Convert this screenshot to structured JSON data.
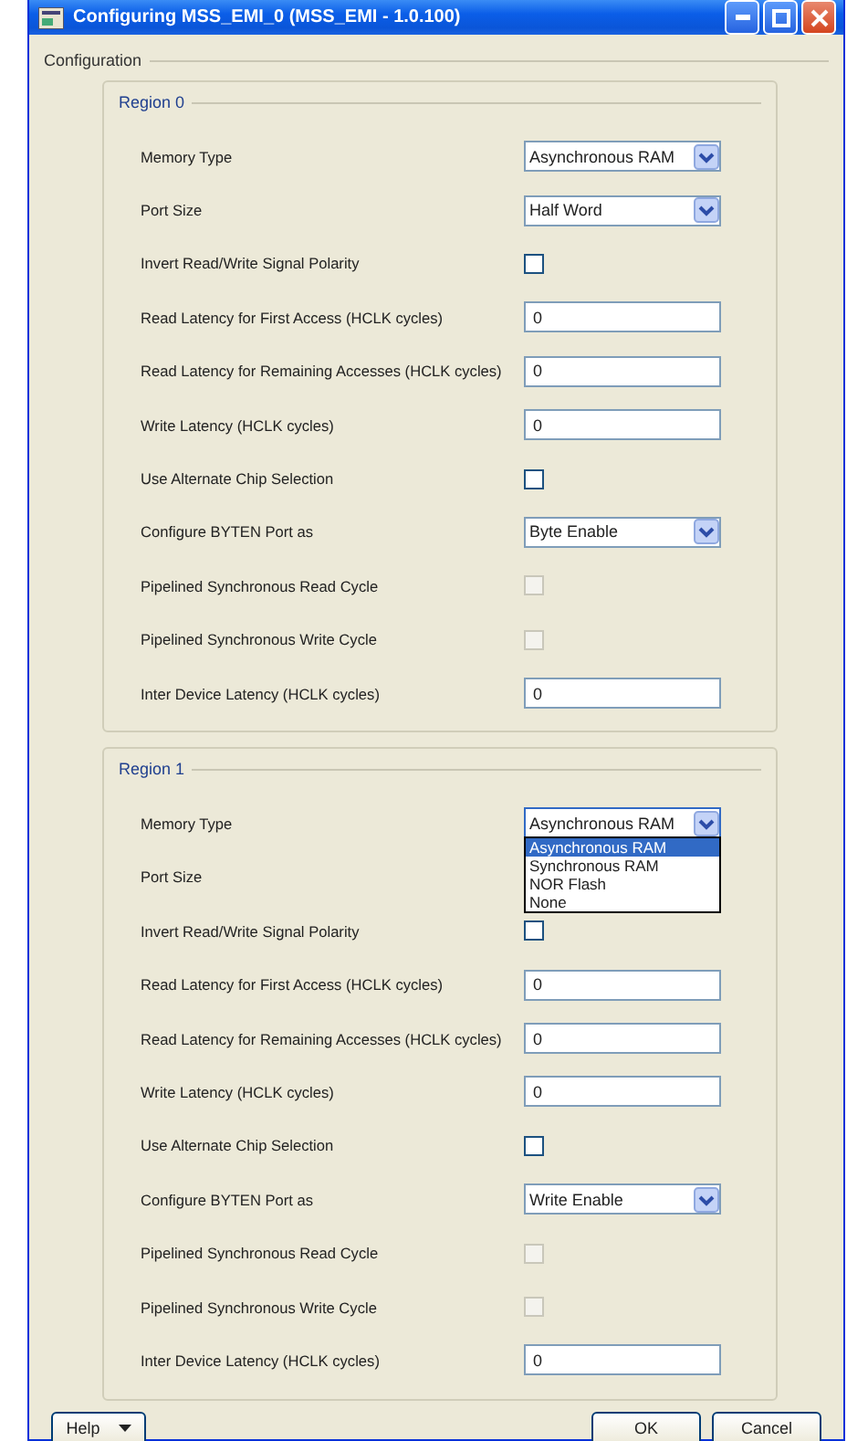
{
  "window": {
    "title": "Configuring MSS_EMI_0 (MSS_EMI - 1.0.100)"
  },
  "configuration": {
    "title": "Configuration",
    "regions": [
      {
        "title": "Region 0",
        "rows": [
          {
            "kind": "select",
            "label": "Memory Type",
            "value": "Asynchronous RAM"
          },
          {
            "kind": "select",
            "label": "Port Size",
            "value": "Half Word"
          },
          {
            "kind": "checkbox",
            "label": "Invert Read/Write Signal Polarity",
            "checked": false,
            "disabled": false
          },
          {
            "kind": "text",
            "label": "Read Latency for First Access (HCLK cycles)",
            "value": "0"
          },
          {
            "kind": "text",
            "label": "Read Latency for Remaining Accesses (HCLK cycles)",
            "value": "0"
          },
          {
            "kind": "text",
            "label": "Write Latency (HCLK cycles)",
            "value": "0"
          },
          {
            "kind": "checkbox",
            "label": "Use Alternate Chip Selection",
            "checked": false,
            "disabled": false
          },
          {
            "kind": "select",
            "label": "Configure BYTEN Port as",
            "value": "Byte Enable"
          },
          {
            "kind": "checkbox",
            "label": "Pipelined Synchronous Read Cycle",
            "checked": false,
            "disabled": true
          },
          {
            "kind": "checkbox",
            "label": "Pipelined Synchronous Write Cycle",
            "checked": false,
            "disabled": true
          },
          {
            "kind": "text",
            "label": "Inter Device Latency (HCLK cycles)",
            "value": "0"
          }
        ]
      },
      {
        "title": "Region 1",
        "rows": [
          {
            "kind": "select",
            "label": "Memory Type",
            "value": "Asynchronous RAM",
            "open": true,
            "options": [
              {
                "label": "Asynchronous RAM",
                "selected": true
              },
              {
                "label": "Synchronous RAM",
                "selected": false
              },
              {
                "label": "NOR Flash",
                "selected": false
              },
              {
                "label": "None",
                "selected": false
              }
            ]
          },
          {
            "kind": "covered",
            "label": "Port Size"
          },
          {
            "kind": "checkbox",
            "label": "Invert Read/Write Signal Polarity",
            "checked": false,
            "disabled": false
          },
          {
            "kind": "text",
            "label": "Read Latency for First Access (HCLK cycles)",
            "value": "0"
          },
          {
            "kind": "text",
            "label": "Read Latency for Remaining Accesses (HCLK cycles)",
            "value": "0"
          },
          {
            "kind": "text",
            "label": "Write Latency (HCLK cycles)",
            "value": "0"
          },
          {
            "kind": "checkbox",
            "label": "Use Alternate Chip Selection",
            "checked": false,
            "disabled": false
          },
          {
            "kind": "select",
            "label": "Configure BYTEN Port as",
            "value": "Write Enable"
          },
          {
            "kind": "checkbox",
            "label": "Pipelined Synchronous Read Cycle",
            "checked": false,
            "disabled": true
          },
          {
            "kind": "checkbox",
            "label": "Pipelined Synchronous Write Cycle",
            "checked": false,
            "disabled": true
          },
          {
            "kind": "text",
            "label": "Inter Device Latency (HCLK cycles)",
            "value": "0"
          }
        ]
      }
    ]
  },
  "buttons": [
    {
      "kind": "menu",
      "label": "Help"
    },
    {
      "kind": "plain",
      "label": "OK"
    },
    {
      "kind": "plain",
      "label": "Cancel"
    }
  ]
}
